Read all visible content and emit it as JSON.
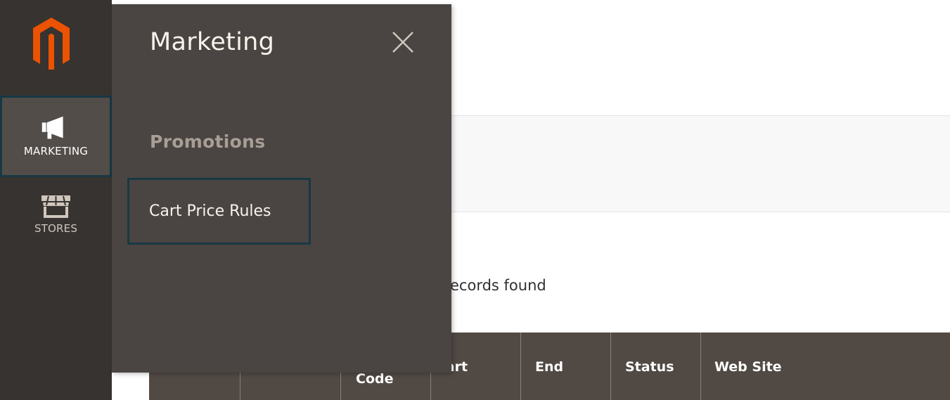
{
  "sidebar": {
    "logo": "magento-logo",
    "items": [
      {
        "label": "MARKETING",
        "icon": "megaphone-icon",
        "active": true
      },
      {
        "label": "STORES",
        "icon": "storefront-icon",
        "active": false
      }
    ]
  },
  "submenu": {
    "title": "Marketing",
    "close_icon": "close-icon",
    "sections": [
      {
        "title": "Promotions",
        "links": [
          {
            "label": "Cart Price Rules",
            "focused": true
          }
        ]
      }
    ]
  },
  "content": {
    "records_text": "ecords found",
    "grid_columns": [
      "",
      "",
      "Code",
      "Start",
      "End",
      "Status",
      "Web Site"
    ]
  },
  "colors": {
    "sidebar_bg": "#373330",
    "submenu_bg": "#4a4542",
    "focus_border": "#183844",
    "logo_orange": "#eb5202",
    "grid_header_bg": "#514943"
  }
}
